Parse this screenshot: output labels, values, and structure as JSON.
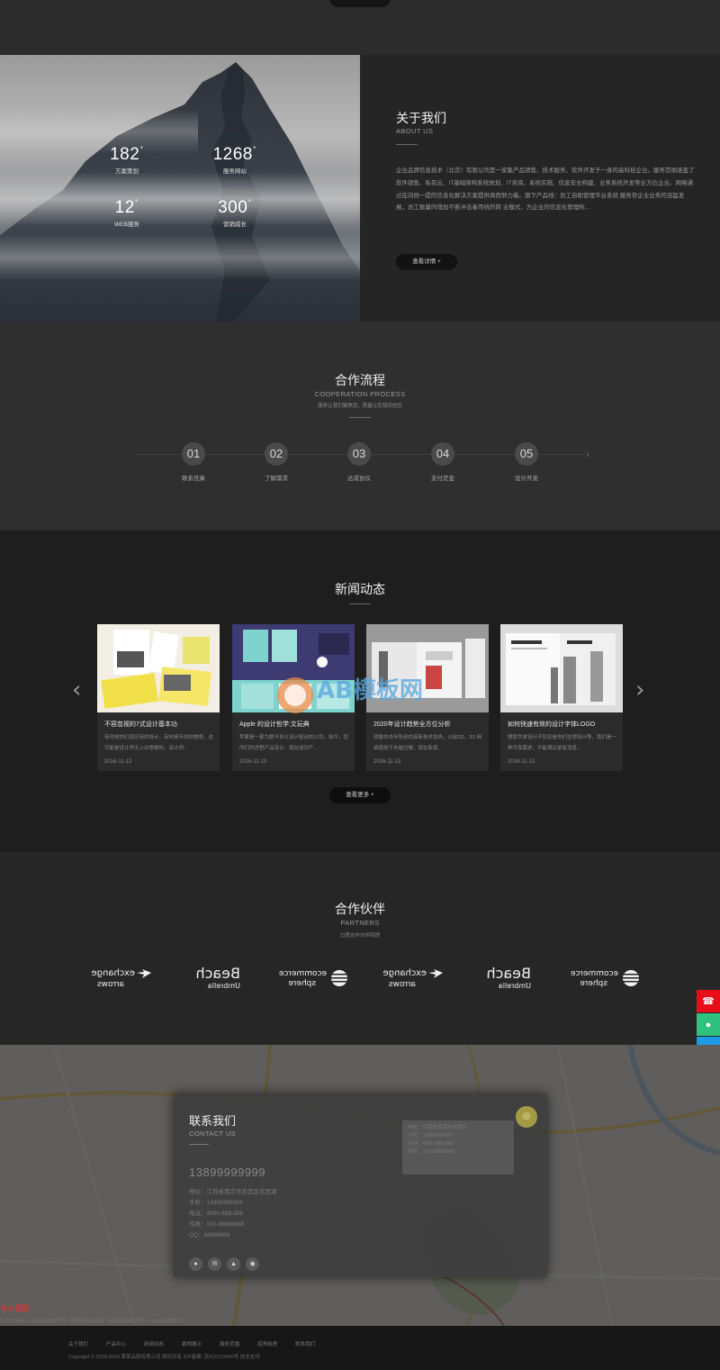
{
  "about": {
    "title": "关于我们",
    "subtitle": "ABOUT US",
    "description": "企业品牌信息技术（北京）有限公司是一家集产品销售、技术服务、软件开发于一身的高科技企业。服务范围涵盖了软件销售、私有云、IT基础架构系统规划、IT咨询、系统实施、信息安全构建、业务系统开发等全方位企业。网络通过在向统一提的信息化解决方案提供商而努力着。旗下产品线：员工自助管理平台系统 服务存企业业务的迅猛发展，员工数量的增加不断冲击着传统的简 业模式，为企业的信息化管理所...",
    "button": "查看详情 +",
    "stats": [
      {
        "value": "182",
        "sup": "+",
        "label": "方案策划"
      },
      {
        "value": "1268",
        "sup": "+",
        "label": "服务网站"
      },
      {
        "value": "12",
        "sup": "+",
        "label": "WEB服务"
      },
      {
        "value": "300",
        "sup": "+",
        "label": "营销成长"
      }
    ]
  },
  "process": {
    "title": "合作流程",
    "subtitle": "COOPERATION PROCESS",
    "desc": "服务让我们聚焦您，质量让您我同信您",
    "steps": [
      {
        "num": "01",
        "label": "联系优果"
      },
      {
        "num": "02",
        "label": "了解需求"
      },
      {
        "num": "03",
        "label": "达成协议"
      },
      {
        "num": "04",
        "label": "支付定金"
      },
      {
        "num": "05",
        "label": "设计开发"
      }
    ]
  },
  "news": {
    "title": "新闻动态",
    "more": "查看更多 +",
    "items": [
      {
        "title": "不容忽视的7式设计基本功",
        "desc": "有时候你们就应用的设计，有时候不如你想想，这可能是设计师无上出想做的。设计师...",
        "date": "2016-11-13"
      },
      {
        "title": "Apple 的设计哲学:文玩典",
        "desc": "苹果是一家为数不多以设计驱动的公司。如今，您所们的进程产品设计。现在成功产...",
        "date": "2016-11-13"
      },
      {
        "title": "2020年设计趋势全方位分析",
        "desc": "就像你去年所说的高新技术加热，以前2D、3D 网络使用于外越过慢，现在新现...",
        "date": "2016-11-13"
      },
      {
        "title": "如何快速有效的设计字体LOGO",
        "desc": "想提字体设计不仅仅是你们在想设计等，我们是一种可靠需求，不能满足是有消息...",
        "date": "2016-11-13"
      }
    ]
  },
  "partners": {
    "title": "合作伙伴",
    "subtitle": "PARTNERS",
    "desc": "过度合作伙伴回馈"
  },
  "contact": {
    "title": "联系我们",
    "subtitle": "CONTACT US",
    "phone": "13899999999",
    "rows": [
      "地址：江苏省南京市玄武区玄武湖",
      "手机：13899999999",
      "电话：4000-888-888",
      "传真：010-88888888",
      "QQ：88888888"
    ],
    "info_lines": [
      "地址：江苏省南京市玄武区",
      "手机：13899999999",
      "电话：4000-888-888",
      "传真：010-88888888"
    ]
  },
  "map": {
    "attribution": "© 2019 Baidu - GS(2018)5572号 - 甲测资字1100930 - 京ICP证030173号 - Data © 长地万方",
    "logo_text": "Bai 百度"
  },
  "footer": {
    "nav": [
      "关于我们",
      "产品中心",
      "新闻动态",
      "案例展示",
      "服务范围",
      "招贤纳贤",
      "联系我们"
    ],
    "copyright": "Copyright © 2009-2019 某某品牌有限公司 版权所有  ICP备案: 京ICP123456号  技术支持"
  },
  "watermark": "AB模板网",
  "colors": {
    "phone_btn": "#e60f19",
    "wechat_btn": "#2ec27e",
    "qq_btn": "#1e9be3",
    "gold": "#a49a44"
  }
}
